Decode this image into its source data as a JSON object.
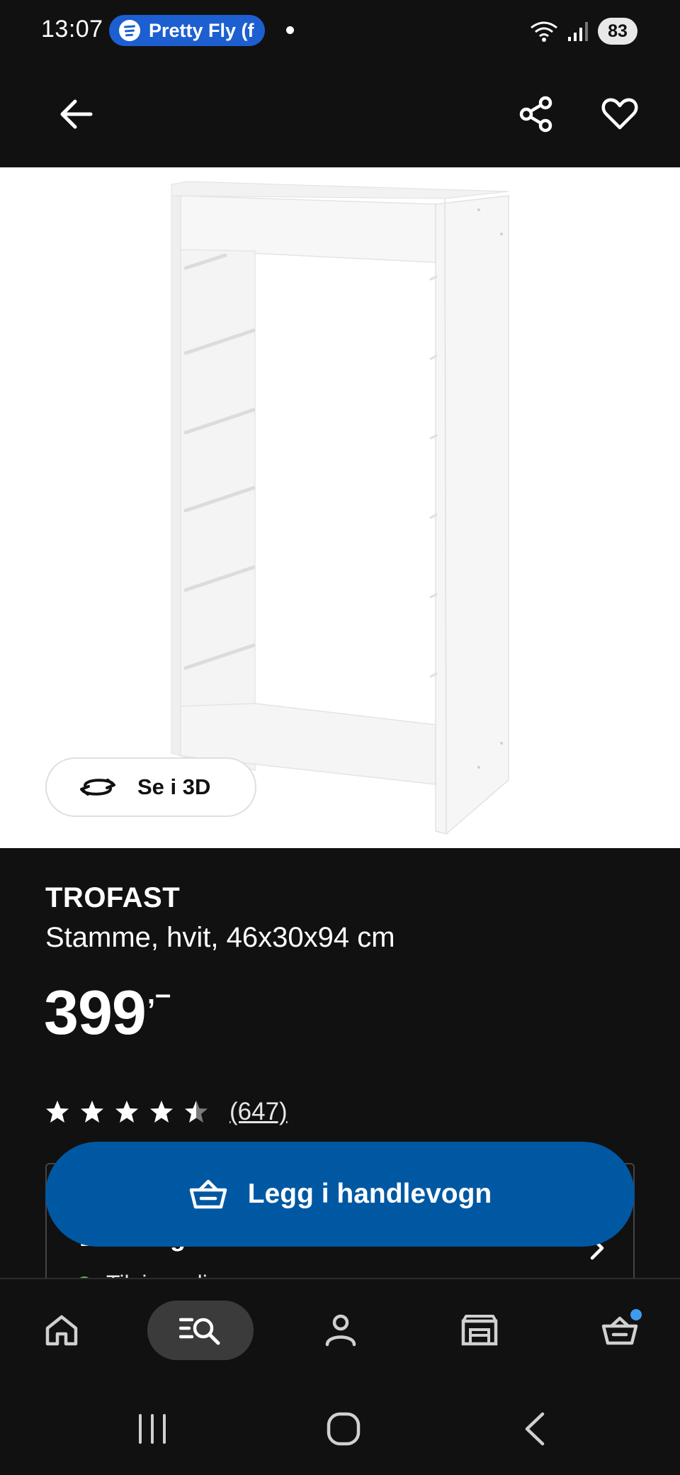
{
  "status_bar": {
    "time": "13:07",
    "media_label": "Pretty Fly (f",
    "battery": "83"
  },
  "top_nav": {
    "back_icon": "arrow-left-icon",
    "share_icon": "share-icon",
    "favorite_icon": "heart-icon"
  },
  "product": {
    "view_3d_label": "Se i 3D",
    "name": "TROFAST",
    "description": "Stamme, hvit, 46x30x94 cm",
    "price": "399",
    "price_suffix": ",–",
    "rating": 4.5,
    "rating_max": 5,
    "review_count": "(647)"
  },
  "availability": {
    "title": "Levering",
    "status": "Tilgjengelig",
    "status_color": "#5dbb63"
  },
  "cta": {
    "add_to_cart_label": "Legg i handlevogn",
    "color": "#0058a3"
  },
  "tab_bar": {
    "tabs": [
      {
        "icon": "home-icon",
        "active": false
      },
      {
        "icon": "search-list-icon",
        "active": true
      },
      {
        "icon": "profile-icon",
        "active": false
      },
      {
        "icon": "store-icon",
        "active": false
      },
      {
        "icon": "cart-icon",
        "active": false,
        "badge": true
      }
    ]
  },
  "colors": {
    "background": "#111111",
    "accent": "#0058a3",
    "badge": "#3d9cf0"
  }
}
